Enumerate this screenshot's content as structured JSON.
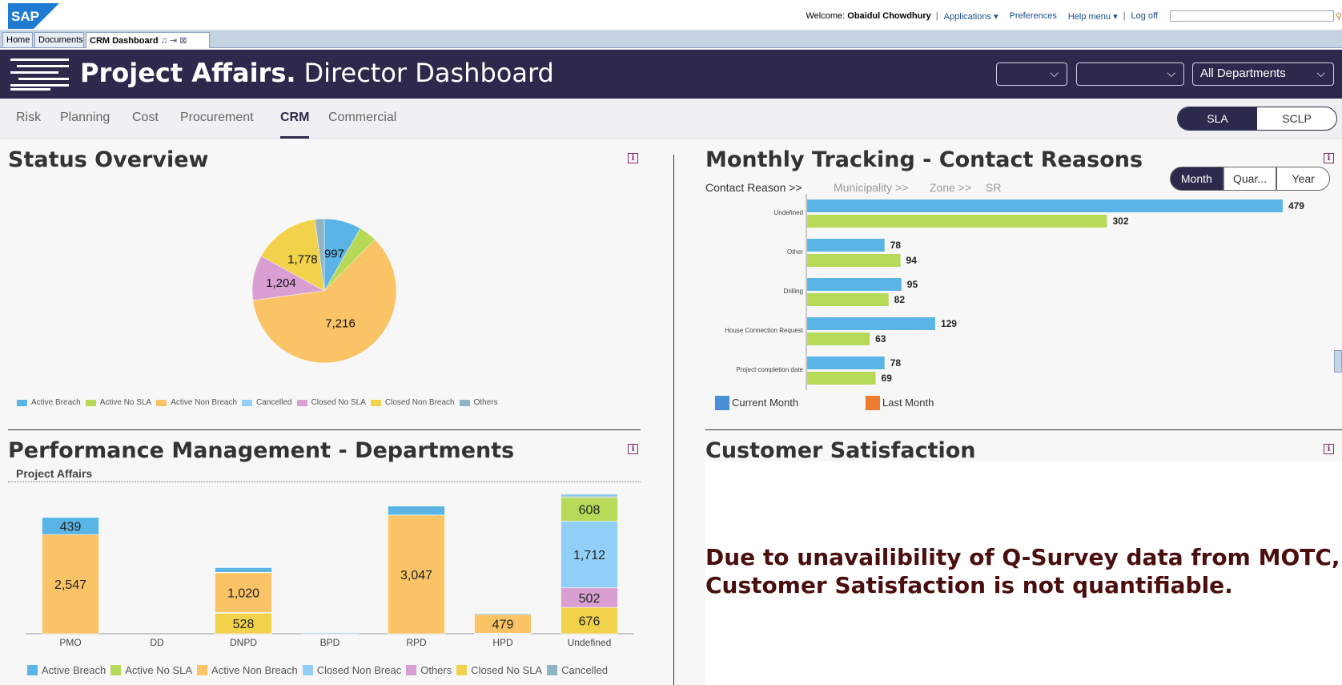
{
  "portal": {
    "logo_text": "SAP",
    "welcome_label": "Welcome:",
    "user": "Obaidul Chowdhury",
    "links": [
      "Applications",
      "Preferences",
      "Help menu",
      "Log off"
    ],
    "tabs": [
      "Home",
      "Documents",
      "CRM Dashboard"
    ]
  },
  "banner": {
    "title": "Project Affairs.",
    "subtitle": "Director Dashboard",
    "dropdowns": [
      "",
      "",
      "All Departments"
    ]
  },
  "nav": {
    "tabs": [
      "Risk",
      "Planning",
      "Cost",
      "Procurement",
      "CRM",
      "Commercial"
    ],
    "active": "CRM",
    "toggle": [
      "SLA",
      "SCLP"
    ],
    "toggle_active": "SLA"
  },
  "status_overview": {
    "title": "Status Overview",
    "info": "i"
  },
  "monthly_tracking": {
    "title": "Monthly Tracking - Contact Reasons",
    "info": "i",
    "crumbs": [
      "Contact Reason >>",
      "Municipality >>",
      "Zone >>",
      "SR"
    ],
    "period": [
      "Month",
      "Quar...",
      "Year"
    ]
  },
  "performance": {
    "title": "Performance Management - Departments",
    "subtitle": "Project Affairs",
    "info": "i"
  },
  "customer_satisfaction": {
    "title": "Customer Satisfaction",
    "info": "i",
    "message_line1": "Due to unavailibility of Q-Survey data from MOTC,",
    "message_line2": "Customer Satisfaction is not quantifiable."
  },
  "colors": {
    "active_breach": "#5ab5e6",
    "active_no_sla": "#b6d957",
    "active_non_breach": "#f9c366",
    "cancelled": "#91cff8",
    "closed_no_sla": "#d99fd2",
    "closed_non_breach": "#f1d24a",
    "others": "#8fb5c2",
    "banner": "#2b2a4c"
  },
  "chart_data": [
    {
      "type": "pie",
      "title": "Status Overview",
      "slices": [
        {
          "name": "Active Breach",
          "value": 997,
          "color": "#5ab5e6"
        },
        {
          "name": "Active No SLA",
          "value": 480,
          "color": "#b6d957"
        },
        {
          "name": "Active Non Breach",
          "value": 7216,
          "color": "#f9c366"
        },
        {
          "name": "Cancelled",
          "value": 0,
          "color": "#91cff8"
        },
        {
          "name": "Closed No SLA",
          "value": 1204,
          "color": "#d99fd2"
        },
        {
          "name": "Closed Non Breach",
          "value": 1778,
          "color": "#f1d24a"
        },
        {
          "name": "Others",
          "value": 250,
          "color": "#8fb5c2"
        }
      ],
      "data_labels": [
        "997",
        "1,778",
        "1,204",
        "7,216"
      ],
      "legend": [
        "Active Breach",
        "Active No SLA",
        "Active Non Breach",
        "Cancelled",
        "Closed No SLA",
        "Closed Non Breach",
        "Others"
      ],
      "legend_placement": "bottom-left"
    },
    {
      "type": "bar",
      "orientation": "horizontal",
      "title": "Monthly Tracking - Contact Reasons",
      "categories": [
        "Undefined",
        "Other",
        "Drilling",
        "House Connection Request",
        "Project completion date"
      ],
      "series": [
        {
          "name": "Current Month",
          "values": [
            479,
            78,
            95,
            129,
            78
          ],
          "color": "#5ab5e6",
          "legend_color": "#4a90d9"
        },
        {
          "name": "Last Month",
          "values": [
            302,
            94,
            82,
            63,
            69
          ],
          "color": "#b6d957",
          "legend_color": "#ef7d2e"
        }
      ],
      "xlim": [
        0,
        500
      ],
      "legend_placement": "bottom-left"
    },
    {
      "type": "bar",
      "stacked": true,
      "title": "Performance Management - Departments",
      "subtitle": "Project Affairs",
      "categories": [
        "PMO",
        "DD",
        "DNPD",
        "BPD",
        "RPD",
        "HPD",
        "Undefined"
      ],
      "series": [
        {
          "name": "Closed No SLA",
          "color": "#f1d24a",
          "values": [
            0,
            0,
            528,
            0,
            0,
            0,
            676
          ]
        },
        {
          "name": "Others",
          "color": "#d99fd2",
          "values": [
            0,
            0,
            0,
            0,
            0,
            0,
            502
          ]
        },
        {
          "name": "Closed Non Breach",
          "color": "#91cff8",
          "values": [
            0,
            0,
            20,
            30,
            0,
            15,
            1712
          ]
        },
        {
          "name": "Active Non Breach",
          "color": "#f9c366",
          "values": [
            2547,
            0,
            1020,
            0,
            3047,
            479,
            0
          ]
        },
        {
          "name": "Active No SLA",
          "color": "#b6d957",
          "values": [
            0,
            0,
            10,
            0,
            0,
            0,
            608
          ]
        },
        {
          "name": "Cancelled",
          "color": "#8fb5c2",
          "values": [
            0,
            0,
            0,
            0,
            0,
            0,
            40
          ]
        },
        {
          "name": "Active Breach",
          "color": "#5ab5e6",
          "values": [
            439,
            0,
            120,
            0,
            230,
            25,
            40
          ]
        }
      ],
      "ylim": [
        0,
        3600
      ],
      "legend": [
        "Active Breach",
        "Active No SLA",
        "Active Non Breach",
        "Closed Non Breac",
        "Others",
        "Closed No SLA",
        "Cancelled"
      ],
      "legend_placement": "bottom-left"
    }
  ]
}
